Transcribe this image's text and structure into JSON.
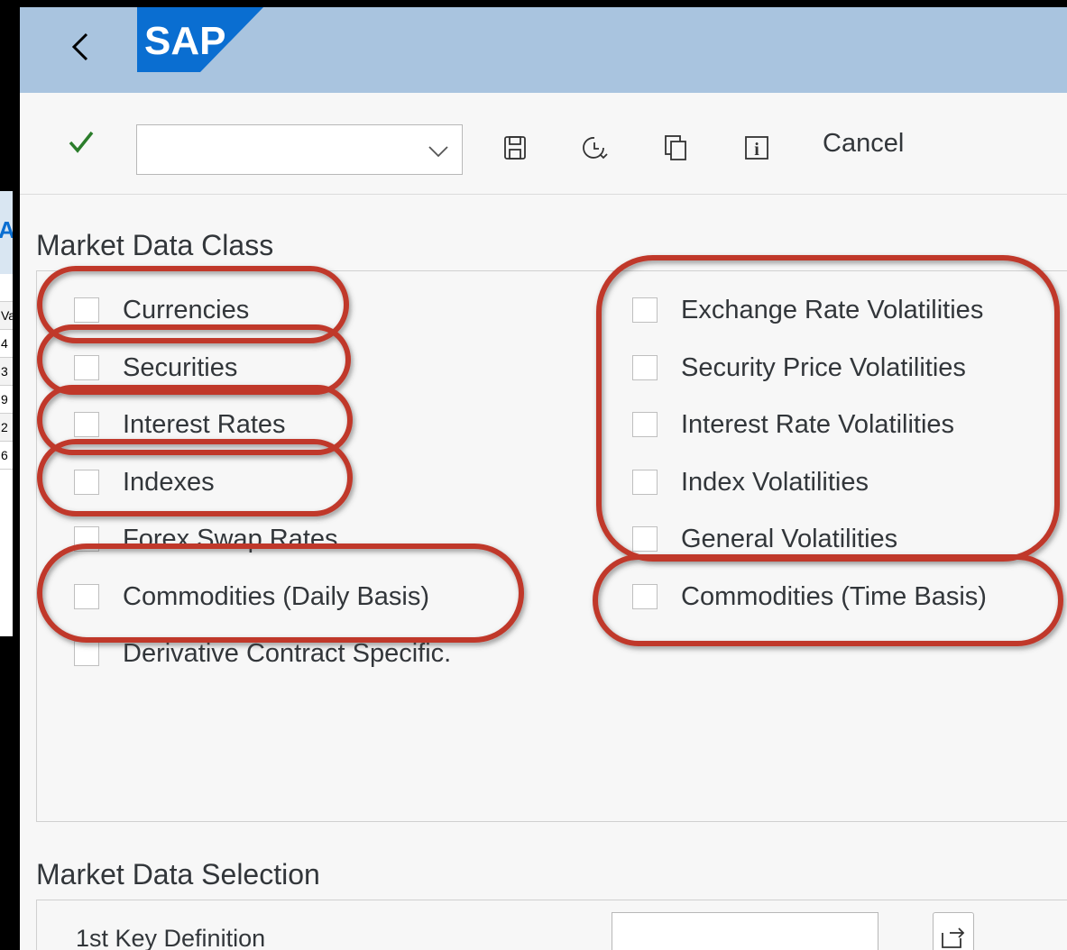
{
  "shell": {
    "back_icon": "chevron-left-icon",
    "logo_text": "SAP",
    "bar_color": "#a9c4df",
    "logo_color": "#0a6ed1"
  },
  "toolbar": {
    "confirm_icon": "checkmark-icon",
    "command_field_value": "",
    "icons": [
      "save-icon",
      "history-icon",
      "copy-icon",
      "info-icon"
    ],
    "cancel_label": "Cancel"
  },
  "market_data_class": {
    "title": "Market Data Class",
    "left_column": [
      {
        "label": "Currencies",
        "checked": false
      },
      {
        "label": "Securities",
        "checked": false
      },
      {
        "label": "Interest Rates",
        "checked": false
      },
      {
        "label": "Indexes",
        "checked": false
      },
      {
        "label": "Forex Swap Rates",
        "checked": false
      },
      {
        "label": "Commodities (Daily Basis)",
        "checked": false
      },
      {
        "label": "Derivative Contract Specific.",
        "checked": false
      }
    ],
    "right_column": [
      {
        "label": "Exchange Rate Volatilities",
        "checked": false
      },
      {
        "label": "Security Price Volatilities",
        "checked": false
      },
      {
        "label": "Interest Rate Volatilities",
        "checked": false
      },
      {
        "label": "Index Volatilities",
        "checked": false
      },
      {
        "label": "General Volatilities",
        "checked": false
      },
      {
        "label": "Commodities (Time Basis)",
        "checked": false
      }
    ]
  },
  "market_data_selection": {
    "title": "Market Data Selection",
    "key_label": "1st Key Definition",
    "key_value": "",
    "key_button_icon": "multiple-selection-icon"
  },
  "background_window": {
    "header_fragment": "A",
    "column_fragment": "Va",
    "rows": [
      "4",
      "3",
      "9",
      "2",
      "6"
    ]
  },
  "annotation_color": "#c0392b"
}
